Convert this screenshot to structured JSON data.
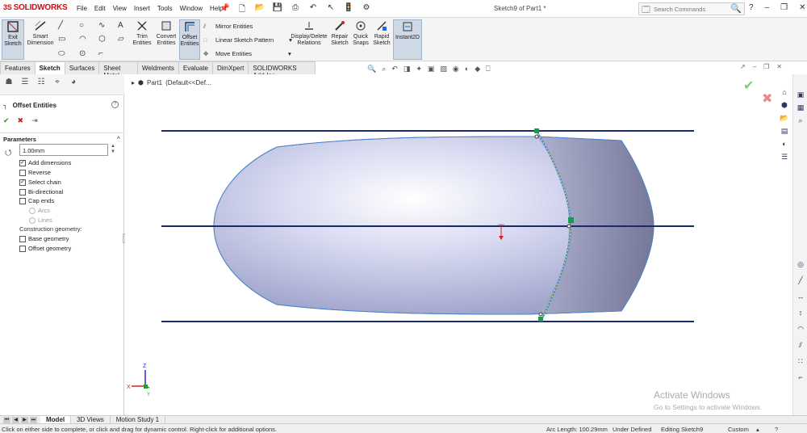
{
  "app": {
    "logo": "SOLIDWORKS",
    "logo_mark": "3S",
    "doc_title": "Sketch9 of Part1 *"
  },
  "menu": [
    "File",
    "Edit",
    "View",
    "Insert",
    "Tools",
    "Window",
    "Help"
  ],
  "search": {
    "placeholder": "Search Commands"
  },
  "ribbon": {
    "exit_sketch": "Exit Sketch",
    "smart_dimension": "Smart Dimension",
    "trim_entities": "Trim Entities",
    "convert_entities": "Convert Entities",
    "offset_entities": "Offset Entities",
    "mirror_entities": "Mirror Entities",
    "linear_sketch_pattern": "Linear Sketch Pattern",
    "move_entities": "Move Entities",
    "display_delete_relations": "Display/Delete Relations",
    "repair_sketch": "Repair Sketch",
    "quick_snaps": "Quick Snaps",
    "rapid_sketch": "Rapid Sketch",
    "instant2d": "Instant2D"
  },
  "tabs": [
    "Features",
    "Sketch",
    "Surfaces",
    "Sheet Metal",
    "Weldments",
    "Evaluate",
    "DimXpert",
    "SOLIDWORKS Add-Ins"
  ],
  "active_tab": "Sketch",
  "property_manager": {
    "title": "Offset Entities",
    "section": "Parameters",
    "distance": "1.00mm",
    "options": [
      {
        "label": "Add dimensions",
        "checked": true
      },
      {
        "label": "Reverse",
        "checked": false
      },
      {
        "label": "Select chain",
        "checked": true
      },
      {
        "label": "Bi-directional",
        "checked": false
      },
      {
        "label": "Cap ends",
        "checked": false
      }
    ],
    "cap_options": [
      "Arcs",
      "Lines"
    ],
    "construction_label": "Construction geometry:",
    "construction_options": [
      {
        "label": "Base geometry",
        "checked": false
      },
      {
        "label": "Offset geometry",
        "checked": false
      }
    ]
  },
  "tree": {
    "item": "Part1",
    "config": "(Default<<Def..."
  },
  "watermark": {
    "line1": "Activate Windows",
    "line2": "Go to Settings to activate Windows."
  },
  "bottom_tabs": [
    "Model",
    "3D Views",
    "Motion Study 1"
  ],
  "status": {
    "message": "Click on either side to complete, or click and drag for dynamic control.  Right-click for additional options.",
    "arc_length": "Arc Length: 100.29mm",
    "defined": "Under Defined",
    "editing": "Editing Sketch9",
    "units": "Custom"
  },
  "triad": {
    "x": "X",
    "y": "Y",
    "z": "Z"
  },
  "colors": {
    "accent": "#d10a11",
    "sketch_line": "#1b2a6b",
    "selection": "#1a9a4a",
    "surface": "#c9cce8"
  }
}
